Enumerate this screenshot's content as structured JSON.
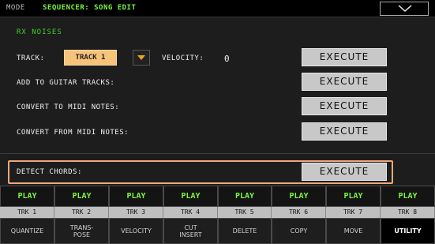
{
  "header": {
    "mode_label": "MODE",
    "mode_value": "SEQUENCER: SONG EDIT"
  },
  "panel": {
    "section_title": "RX NOISES",
    "track_label": "TRACK:",
    "track_value": "TRACK 1",
    "velocity_label": "VELOCITY:",
    "velocity_value": "0",
    "rows": [
      {
        "label": "ADD TO GUITAR TRACKS:",
        "button": "EXECUTE"
      },
      {
        "label": "CONVERT TO MIDI NOTES:",
        "button": "EXECUTE"
      },
      {
        "label": "CONVERT FROM MIDI NOTES:",
        "button": "EXECUTE"
      }
    ],
    "track_button": "EXECUTE",
    "detect_label": "DETECT CHORDS:",
    "detect_button": "EXECUTE"
  },
  "strip": {
    "play": [
      "PLAY",
      "PLAY",
      "PLAY",
      "PLAY",
      "PLAY",
      "PLAY",
      "PLAY",
      "PLAY"
    ],
    "tracks": [
      "TRK 1",
      "TRK 2",
      "TRK 3",
      "TRK 4",
      "TRK 5",
      "TRK 6",
      "TRK 7",
      "TRK 8"
    ],
    "utility": [
      "QUANTIZE",
      "TRANS-\nPOSE",
      "VELOCITY",
      "CUT\nINSERT",
      "DELETE",
      "COPY",
      "MOVE",
      "UTILITY"
    ]
  },
  "colors": {
    "accent_green": "#7df542",
    "highlight_orange": "#f0a77a",
    "combo_fill": "#f7c27a"
  }
}
